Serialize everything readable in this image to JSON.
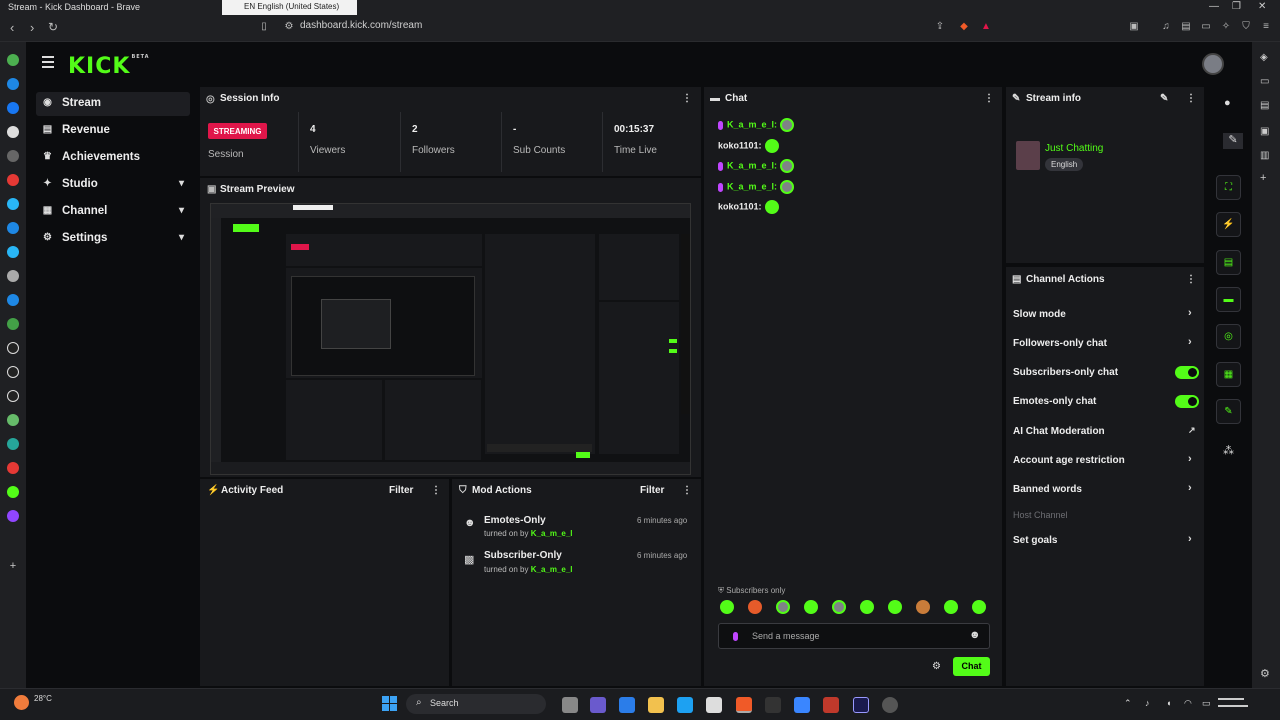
{
  "browser": {
    "tab_title": "Stream - Kick Dashboard - Brave",
    "lang_popup": "EN English (United States)",
    "url": "dashboard.kick.com/stream"
  },
  "brand": {
    "logo": "KICK",
    "logo_tag": "BETA"
  },
  "sidebar": {
    "items": [
      {
        "label": "Stream",
        "icon": "stream-icon"
      },
      {
        "label": "Revenue",
        "icon": "revenue-icon"
      },
      {
        "label": "Achievements",
        "icon": "trophy-icon"
      },
      {
        "label": "Studio",
        "icon": "studio-icon"
      },
      {
        "label": "Channel",
        "icon": "channel-icon"
      },
      {
        "label": "Settings",
        "icon": "gear-icon"
      }
    ]
  },
  "session": {
    "title": "Session Info",
    "status": "STREAMING",
    "status_label": "Session",
    "stats": [
      {
        "value": "4",
        "label": "Viewers"
      },
      {
        "value": "2",
        "label": "Followers"
      },
      {
        "value": "-",
        "label": "Sub Counts"
      },
      {
        "value": "00:15:37",
        "label": "Time Live"
      }
    ]
  },
  "preview": {
    "title": "Stream Preview"
  },
  "activity": {
    "title": "Activity Feed",
    "filter": "Filter"
  },
  "mod_actions": {
    "title": "Mod Actions",
    "filter": "Filter",
    "items": [
      {
        "title": "Emotes-Only",
        "by": "turned on by",
        "user": "K_a_m_e_l",
        "time": "6 minutes ago"
      },
      {
        "title": "Subscriber-Only",
        "by": "turned on by",
        "user": "K_a_m_e_l",
        "time": "6 minutes ago"
      }
    ]
  },
  "chat": {
    "title": "Chat",
    "messages": [
      {
        "user": "K_a_m_e_l:"
      },
      {
        "user": "koko1101:"
      },
      {
        "user": "K_a_m_e_l:"
      },
      {
        "user": "K_a_m_e_l:"
      },
      {
        "user": "koko1101:"
      }
    ],
    "mode": "Subscribers only",
    "placeholder": "Send a message",
    "send": "Chat"
  },
  "stream_info": {
    "title": "Stream info",
    "category": "Just Chatting",
    "language": "English"
  },
  "channel_actions": {
    "title": "Channel Actions",
    "items": [
      {
        "label": "Slow mode"
      },
      {
        "label": "Followers-only chat"
      },
      {
        "label": "Subscribers-only chat"
      },
      {
        "label": "Emotes-only chat"
      },
      {
        "label": "AI Chat Moderation"
      },
      {
        "label": "Account age restriction"
      },
      {
        "label": "Banned words"
      },
      {
        "label": "Host Channel"
      },
      {
        "label": "Set goals"
      }
    ]
  },
  "taskbar": {
    "weather": "28°C",
    "search": "Search"
  },
  "colors": {
    "brand": "#53fc18",
    "live": "#e0164a",
    "panel": "#18191c"
  }
}
